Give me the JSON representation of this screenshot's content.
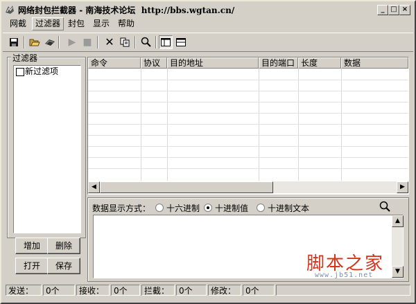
{
  "window": {
    "title": "网络封包拦截器",
    "title_sep": " - ",
    "subtitle": "南海技术论坛",
    "url": "http://bbs.wgtan.cn/"
  },
  "menu": [
    "网截",
    "过滤器",
    "封包",
    "显示",
    "帮助"
  ],
  "toolbar": {
    "icons": [
      "save-icon",
      "open-icon",
      "keyboard-icon",
      "play-icon",
      "stop-icon",
      "delete-icon",
      "copy-icon",
      "find-icon",
      "layout-split-icon",
      "layout-list-icon"
    ]
  },
  "filter_panel": {
    "label": "过滤器",
    "items": [
      {
        "label": "新过滤项",
        "checked": false
      }
    ],
    "buttons": {
      "add": "增加",
      "remove": "删除",
      "open": "打开",
      "save": "保存"
    }
  },
  "table": {
    "columns": [
      "命令",
      "协议",
      "目的地址",
      "目的端口",
      "长度",
      "数据"
    ],
    "rows": []
  },
  "data_view": {
    "display_label": "数据显示方式：",
    "options": [
      "十六进制",
      "十进制值",
      "十进制文本"
    ],
    "selected": "十进制值"
  },
  "status": {
    "send_label": "发送：",
    "send_value": "0个",
    "recv_label": "接收：",
    "recv_value": "0个",
    "block_label": "拦截：",
    "block_value": "0个",
    "modify_label": "修改：",
    "modify_value": "0个"
  },
  "watermark": {
    "text": "脚本之家",
    "url": "www.jb51.net"
  }
}
